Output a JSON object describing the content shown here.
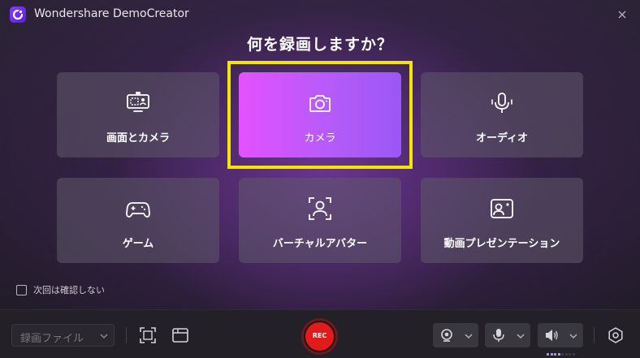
{
  "window": {
    "title": "Wondershare DemoCreator"
  },
  "heading": "何を録画しますか？",
  "modes": [
    {
      "id": "screen-camera",
      "label": "画面とカメラ",
      "icon": "screen-camera-icon"
    },
    {
      "id": "camera",
      "label": "カメラ",
      "icon": "camera-icon",
      "selected": true
    },
    {
      "id": "audio",
      "label": "オーディオ",
      "icon": "microphone-icon"
    },
    {
      "id": "game",
      "label": "ゲーム",
      "icon": "gamepad-icon"
    },
    {
      "id": "virtual-avatar",
      "label": "バーチャルアバター",
      "icon": "avatar-frame-icon"
    },
    {
      "id": "video-presentation",
      "label": "動画プレゼンテーション",
      "icon": "presentation-icon"
    }
  ],
  "skip_next": {
    "label": "次回は確認しない",
    "checked": false
  },
  "toolbar": {
    "file_select": "録画ファイル",
    "rec_label": "REC",
    "volume_level": 0.4
  },
  "colors": {
    "accent_start": "#e451ff",
    "accent_end": "#9b57f6",
    "highlight": "#f5e600",
    "record": "#e01b1b"
  }
}
